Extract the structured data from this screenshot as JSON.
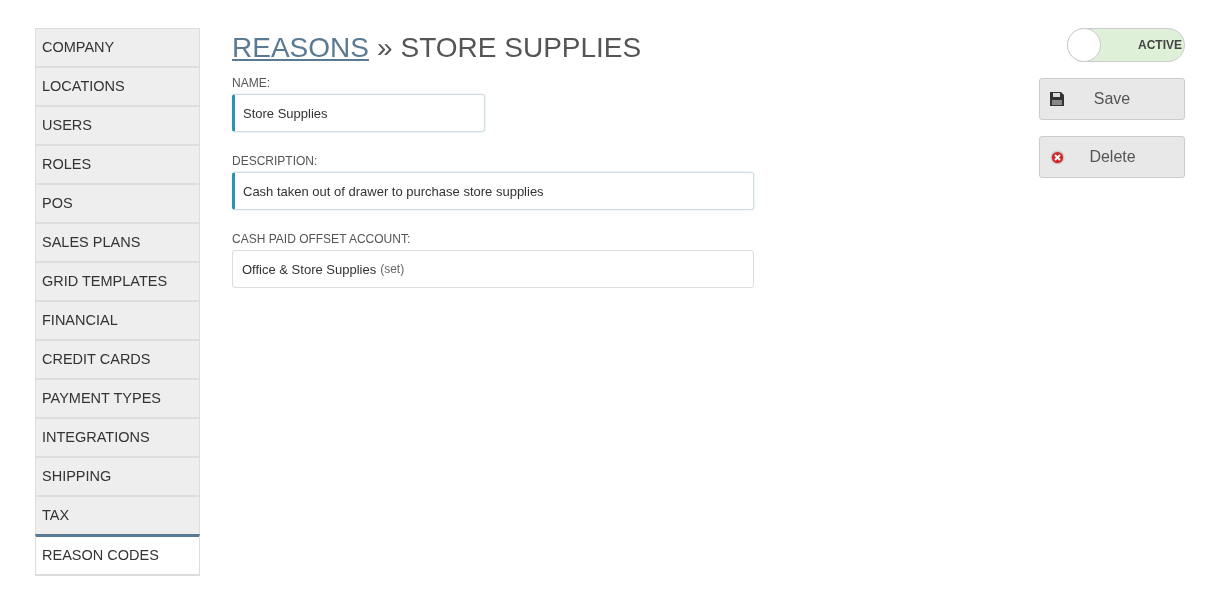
{
  "sidebar": {
    "items": [
      {
        "label": "COMPANY",
        "selected": false
      },
      {
        "label": "LOCATIONS",
        "selected": false
      },
      {
        "label": "USERS",
        "selected": false
      },
      {
        "label": "ROLES",
        "selected": false
      },
      {
        "label": "POS",
        "selected": false
      },
      {
        "label": "SALES PLANS",
        "selected": false
      },
      {
        "label": "GRID TEMPLATES",
        "selected": false
      },
      {
        "label": "FINANCIAL",
        "selected": false
      },
      {
        "label": "CREDIT CARDS",
        "selected": false
      },
      {
        "label": "PAYMENT TYPES",
        "selected": false
      },
      {
        "label": "INTEGRATIONS",
        "selected": false
      },
      {
        "label": "SHIPPING",
        "selected": false
      },
      {
        "label": "TAX",
        "selected": false
      },
      {
        "label": "REASON CODES",
        "selected": true
      }
    ]
  },
  "heading": {
    "link": "REASONS",
    "separator": "»",
    "title": "STORE SUPPLIES"
  },
  "fields": [
    {
      "label": "NAME:",
      "value": "Store Supplies",
      "focused": true,
      "kind": "short"
    },
    {
      "label": "DESCRIPTION:",
      "value": "Cash taken out of drawer to purchase store supplies",
      "focused": true,
      "kind": "long"
    },
    {
      "label": "CASH PAID OFFSET ACCOUNT:",
      "value": "Office & Store Supplies",
      "suffix": "(set)",
      "focused": false,
      "kind": "long"
    }
  ],
  "toggle": {
    "label": "ACTIVE",
    "on": true
  },
  "buttons": [
    {
      "label": "Save",
      "kind": "save"
    },
    {
      "label": "Delete",
      "kind": "delete"
    }
  ]
}
